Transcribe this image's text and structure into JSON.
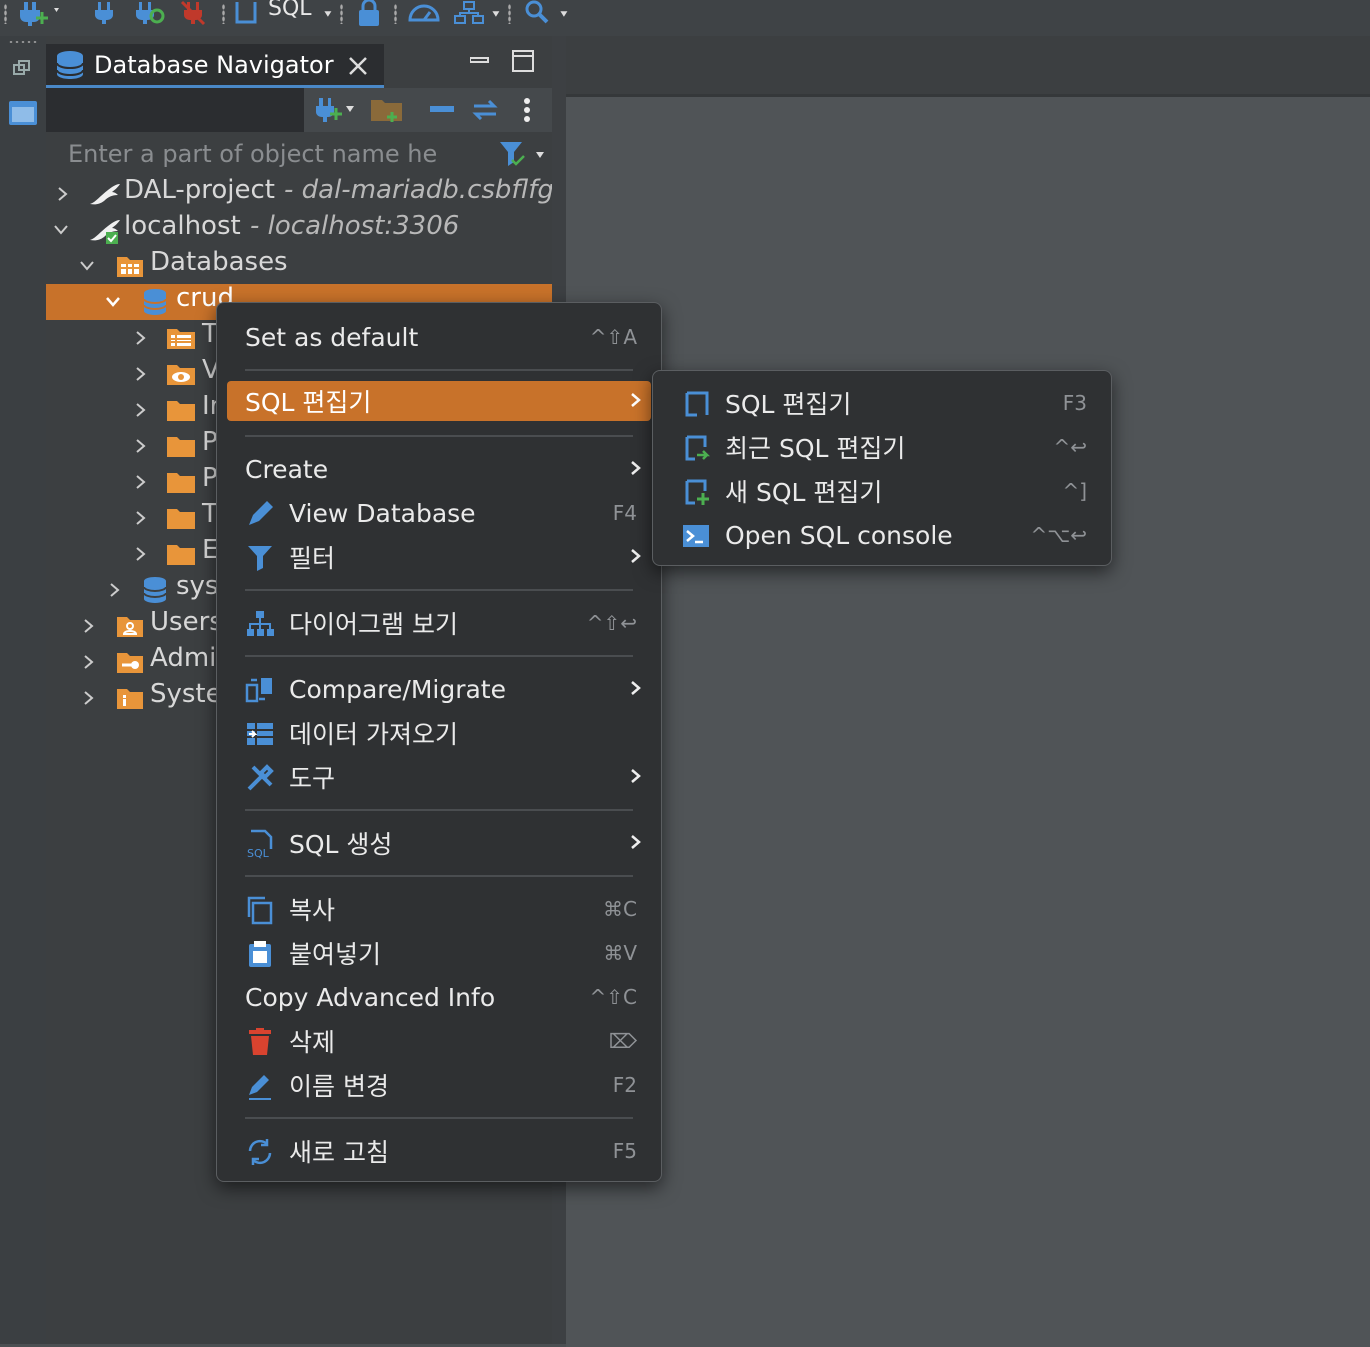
{
  "toolbar": {
    "sql_label": "SQL"
  },
  "navigator": {
    "tab_title": "Database Navigator",
    "filter_placeholder": "Enter a part of object name he",
    "tree": {
      "dal_project": {
        "name": "DAL-project",
        "sub": "- dal-mariadb.csbflfgg"
      },
      "localhost": {
        "name": "localhost",
        "sub": "- localhost:3306"
      },
      "databases": "Databases",
      "crud": "crud",
      "crud_children": [
        "T",
        "V",
        "Ir",
        "P",
        "P",
        "T",
        "E"
      ],
      "sys": "sys",
      "users": "Users",
      "admin": "Admir",
      "system": "Syste"
    }
  },
  "context_menu": {
    "set_default": {
      "label": "Set as default",
      "shortcut": "^⇧A"
    },
    "sql_editor": {
      "label": "SQL 편집기"
    },
    "create": {
      "label": "Create"
    },
    "view_database": {
      "label": "View Database",
      "shortcut": "F4"
    },
    "filter": {
      "label": "필터"
    },
    "diagram": {
      "label": "다이어그램 보기",
      "shortcut": "^⇧↩"
    },
    "compare": {
      "label": "Compare/Migrate"
    },
    "import": {
      "label": "데이터 가져오기"
    },
    "tools": {
      "label": "도구"
    },
    "sql_gen": {
      "label": "SQL 생성"
    },
    "copy": {
      "label": "복사",
      "shortcut": "⌘C"
    },
    "paste": {
      "label": "붙여넣기",
      "shortcut": "⌘V"
    },
    "copy_adv": {
      "label": "Copy Advanced Info",
      "shortcut": "^⇧C"
    },
    "delete": {
      "label": "삭제",
      "shortcut": "⌦"
    },
    "rename": {
      "label": "이름 변경",
      "shortcut": "F2"
    },
    "refresh": {
      "label": "새로 고침",
      "shortcut": "F5"
    }
  },
  "submenu": {
    "sql_editor": {
      "label": "SQL 편집기",
      "shortcut": "F3"
    },
    "recent_sql": {
      "label": "최근 SQL 편집기",
      "shortcut": "^↩"
    },
    "new_sql": {
      "label": "새 SQL 편집기",
      "shortcut": "^]"
    },
    "console": {
      "label": "Open SQL console",
      "shortcut": "^⌥↩"
    }
  },
  "colors": {
    "accent": "#c8722a",
    "tab_underline": "#4a88c7",
    "icon_blue": "#4a8fd6",
    "folder_orange": "#e8953a"
  }
}
